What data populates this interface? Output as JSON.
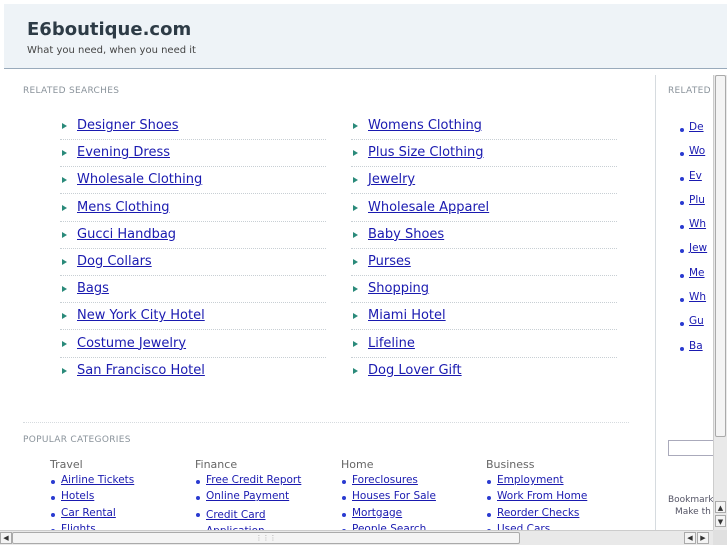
{
  "header": {
    "site_title": "E6boutique.com",
    "tagline": "What you need, when you need it"
  },
  "related": {
    "title": "RELATED SEARCHES",
    "left": [
      "Designer Shoes",
      "Evening Dress",
      "Wholesale Clothing",
      "Mens Clothing",
      "Gucci Handbag",
      "Dog Collars",
      "Bags",
      "New York City Hotel",
      "Costume Jewelry",
      "San Francisco Hotel"
    ],
    "right": [
      "Womens Clothing",
      "Plus Size Clothing",
      "Jewelry",
      "Wholesale Apparel",
      "Baby Shoes",
      "Purses",
      "Shopping",
      "Miami Hotel",
      "Lifeline",
      "Dog Lover Gift"
    ]
  },
  "popular": {
    "title": "POPULAR CATEGORIES",
    "categories": [
      {
        "name": "Travel",
        "links": [
          "Airline Tickets",
          "Hotels",
          "Car Rental",
          "Flights"
        ]
      },
      {
        "name": "Finance",
        "links": [
          "Free Credit Report",
          "Online Payment",
          "Credit Card Application"
        ]
      },
      {
        "name": "Home",
        "links": [
          "Foreclosures",
          "Houses For Sale",
          "Mortgage",
          "People Search"
        ]
      },
      {
        "name": "Business",
        "links": [
          "Employment",
          "Work From Home",
          "Reorder Checks",
          "Used Cars"
        ]
      }
    ]
  },
  "sidebar": {
    "title": "RELATED",
    "items": [
      "De",
      "Wo",
      "Ev",
      "Plu",
      "Wh",
      "Jew",
      "Me",
      "Wh",
      "Gu",
      "Ba"
    ],
    "bookmark": "Bookmark",
    "make": "Make th"
  },
  "scrollbars": {
    "up": "▲",
    "down": "▼",
    "left": "◀",
    "right": "▶",
    "grip": "⋮⋮⋮"
  }
}
